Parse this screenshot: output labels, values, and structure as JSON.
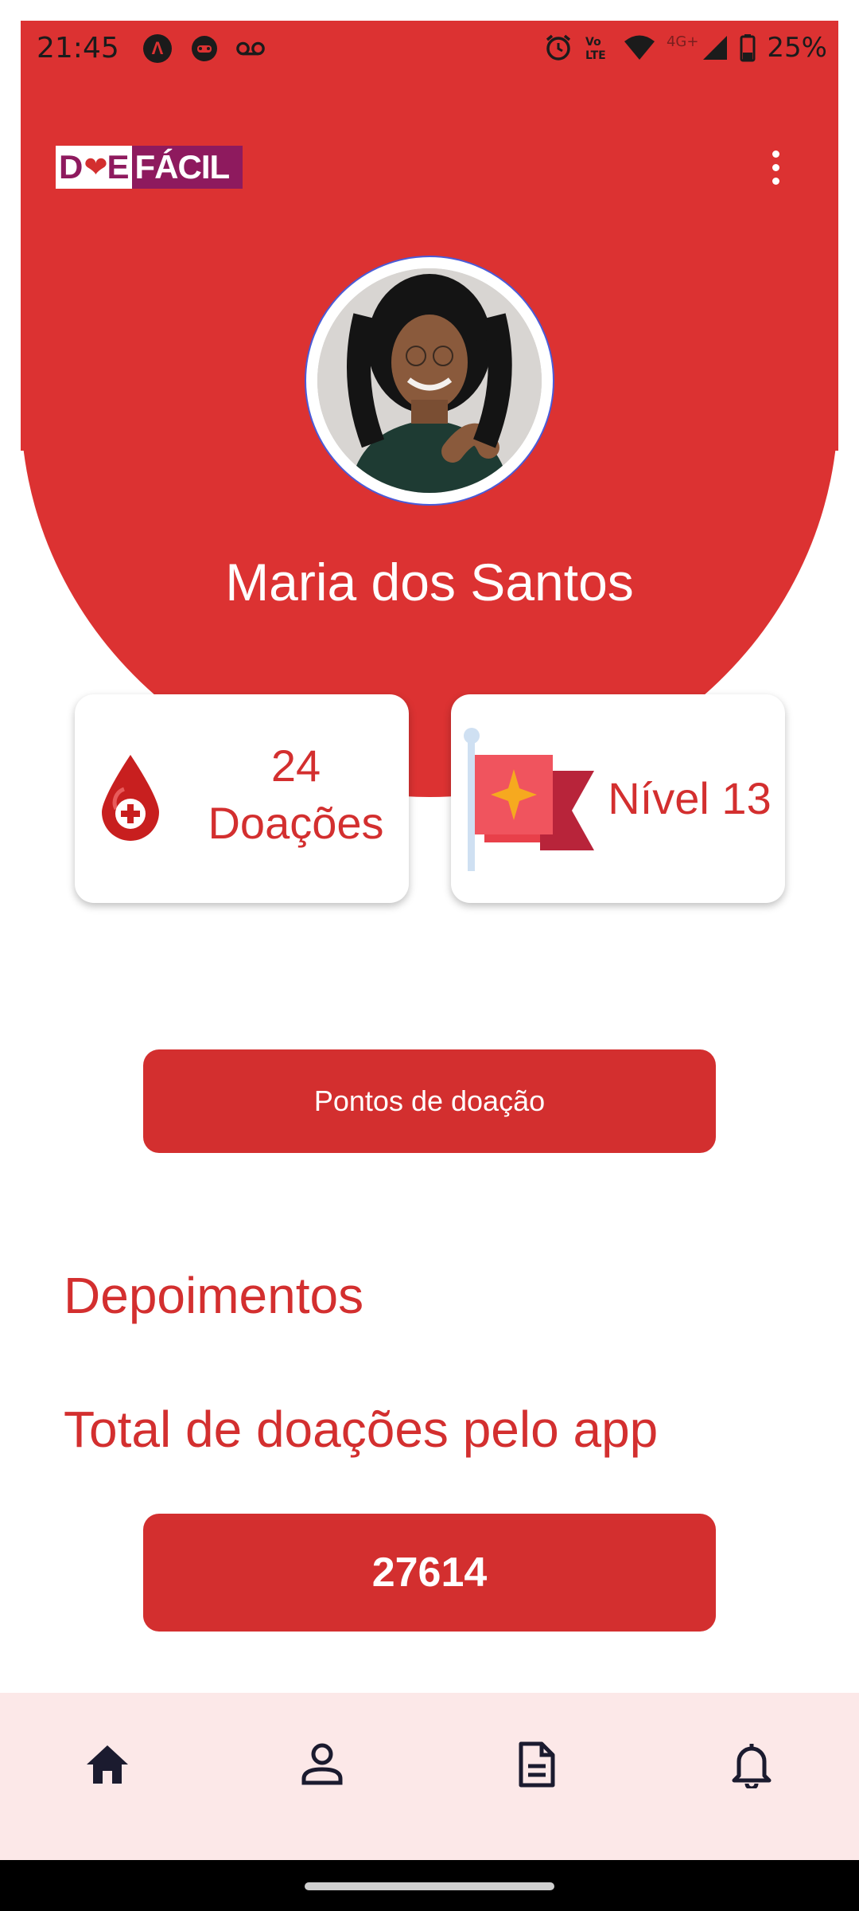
{
  "status_bar": {
    "time": "21:45",
    "battery": "25%",
    "network_label": "4G+",
    "icons": [
      "arc-app-icon",
      "game-controller-icon",
      "voicemail-icon",
      "alarm-icon",
      "volte-icon",
      "wifi-icon",
      "signal-icon",
      "battery-icon"
    ]
  },
  "header": {
    "logo_text_left": "D",
    "logo_text_mid": "E",
    "logo_text_right": "FÁCIL",
    "menu_icon": "more-vertical-icon"
  },
  "profile": {
    "name": "Maria dos Santos"
  },
  "stats": {
    "donations_count": "24",
    "donations_label": "Doações",
    "level_label": "Nível 13",
    "donations_icon": "blood-drop-icon",
    "level_icon": "flag-icon"
  },
  "actions": {
    "points_button": "Pontos de doação"
  },
  "sections": {
    "testimonials_title": "Depoimentos",
    "total_title": "Total de doações pelo app",
    "total_value": "27614"
  },
  "bottom_nav": {
    "items": [
      "home-icon",
      "profile-icon",
      "document-icon",
      "bell-icon"
    ],
    "active": "home-icon"
  },
  "colors": {
    "primary_red": "#dc3232",
    "button_red": "#d32f2f",
    "logo_purple": "#8e1a5e",
    "nav_background": "#fce8e8",
    "nav_icon": "#1b1b2f"
  }
}
